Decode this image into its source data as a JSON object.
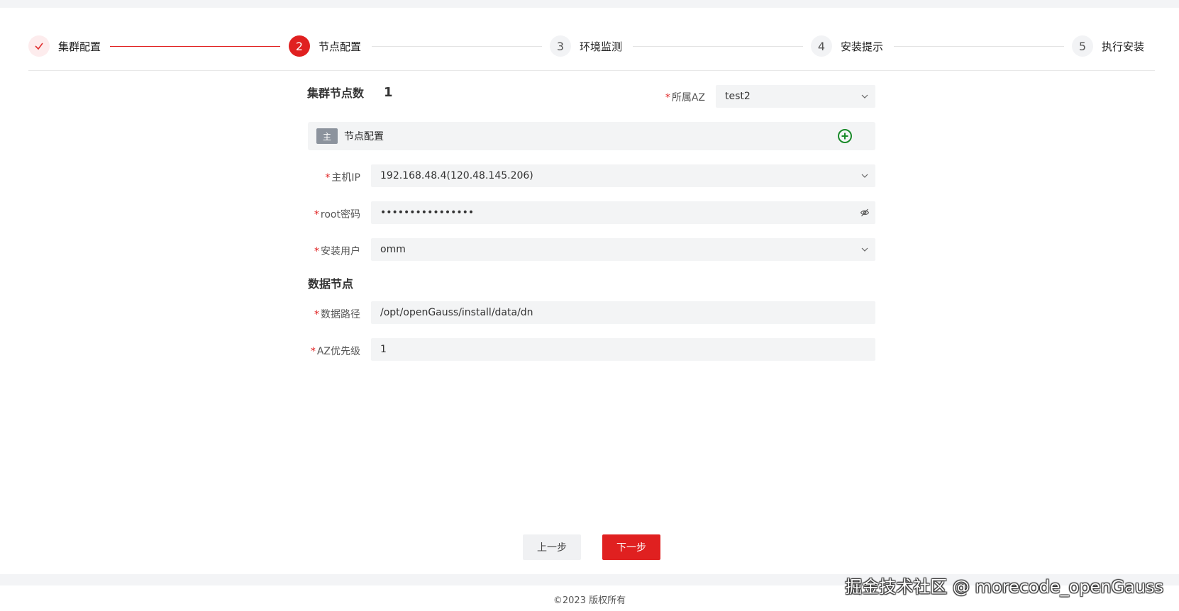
{
  "steps": [
    {
      "number": "✓",
      "label": "集群配置",
      "state": "done"
    },
    {
      "number": "2",
      "label": "节点配置",
      "state": "active"
    },
    {
      "number": "3",
      "label": "环境监测",
      "state": "todo"
    },
    {
      "number": "4",
      "label": "安装提示",
      "state": "todo"
    },
    {
      "number": "5",
      "label": "执行安装",
      "state": "todo"
    }
  ],
  "cluster": {
    "node_count_label": "集群节点数",
    "node_count_value": "1",
    "az_label": "所属AZ",
    "az_value": "test2"
  },
  "node": {
    "badge": "主",
    "title": "节点配置",
    "host_ip_label": "主机IP",
    "host_ip_value": "192.168.48.4(120.48.145.206)",
    "root_password_label": "root密码",
    "root_password_value": "••••••••••••••••",
    "install_user_label": "安装用户",
    "install_user_value": "omm"
  },
  "data_node": {
    "section_title": "数据节点",
    "data_path_label": "数据路径",
    "data_path_value": "/opt/openGauss/install/data/dn",
    "az_priority_label": "AZ优先级",
    "az_priority_value": "1"
  },
  "required_mark": "*",
  "buttons": {
    "prev": "上一步",
    "next": "下一步"
  },
  "footer": {
    "copyright": "©2023 版权所有"
  },
  "watermark": "掘金技术社区 @ morecode_openGauss",
  "colors": {
    "accent": "#e02020",
    "field_bg": "#f3f4f5",
    "add_icon": "#1a8a2a"
  }
}
